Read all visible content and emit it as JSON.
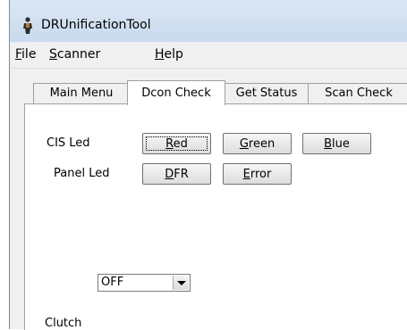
{
  "window": {
    "title": "DRUnificationTool"
  },
  "menu": {
    "file": {
      "mnemonic": "F",
      "rest": "ile"
    },
    "scanner": {
      "mnemonic": "S",
      "rest": "canner"
    },
    "help": {
      "mnemonic": "H",
      "rest": "elp"
    }
  },
  "tabs": [
    {
      "label": "Main Menu",
      "selected": false
    },
    {
      "label": "Dcon Check",
      "selected": true
    },
    {
      "label": "Get Status",
      "selected": false
    },
    {
      "label": "Scan Check",
      "selected": false
    }
  ],
  "panel": {
    "cis_led_label": "CIS Led",
    "cis_buttons": [
      {
        "mnemonic": "R",
        "rest": "ed"
      },
      {
        "mnemonic": "G",
        "rest": "reen"
      },
      {
        "mnemonic": "B",
        "rest": "lue"
      }
    ],
    "panel_led_label": "Panel Led",
    "panel_buttons": [
      {
        "mnemonic": "D",
        "rest": "FR"
      },
      {
        "mnemonic": "E",
        "rest": "rror"
      }
    ],
    "clutch_label": "Clutch",
    "clutch_value": "OFF"
  },
  "icons": {
    "app": "app-person-icon",
    "dropdown": "chevron-down-icon"
  },
  "colors": {
    "titlebar": "#c9daee",
    "panel": "#ffffff"
  }
}
